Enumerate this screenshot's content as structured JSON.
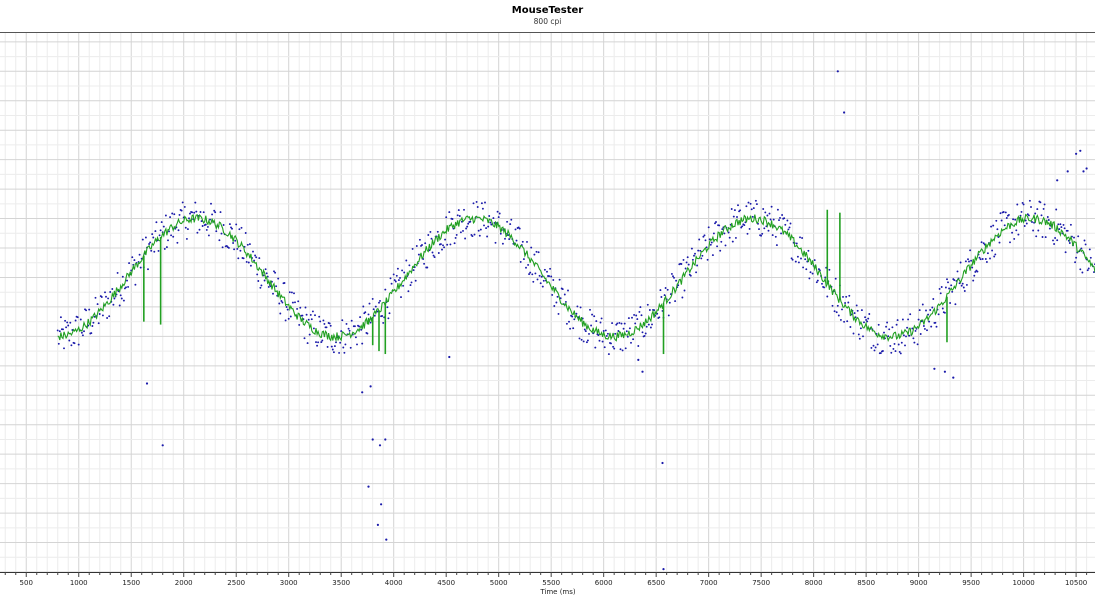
{
  "header": {
    "title": "MouseTester",
    "subtitle": "800 cpi"
  },
  "chart_data": {
    "type": "scatter",
    "title": "MouseTester",
    "subtitle": "800 cpi",
    "xlabel": "Time (ms)",
    "ylabel": "",
    "xlim": [
      250,
      10680
    ],
    "ylim": [
      -10,
      8.3
    ],
    "x_ticks": [
      500,
      1000,
      1500,
      2000,
      2500,
      3000,
      3500,
      4000,
      4500,
      5000,
      5500,
      6000,
      6500,
      7000,
      7500,
      8000,
      8500,
      9000,
      9500,
      10000,
      10500
    ],
    "grid": true,
    "legend": "none",
    "series": [
      {
        "role": "samples",
        "color": "#1a1aaa",
        "marker": "dot",
        "sine": {
          "x_start": 800,
          "x_end": 10700,
          "step": 10,
          "amplitude": 2.0,
          "period": 2650,
          "phase_x": 1460,
          "noise": 0.65
        },
        "outliers": [
          {
            "x": 1650,
            "y": -3.6
          },
          {
            "x": 1800,
            "y": -5.7
          },
          {
            "x": 3700,
            "y": -3.9
          },
          {
            "x": 3780,
            "y": -3.7
          },
          {
            "x": 3800,
            "y": -5.5
          },
          {
            "x": 3870,
            "y": -5.7
          },
          {
            "x": 3920,
            "y": -5.5
          },
          {
            "x": 3760,
            "y": -7.1
          },
          {
            "x": 3880,
            "y": -7.7
          },
          {
            "x": 3850,
            "y": -8.4
          },
          {
            "x": 3930,
            "y": -8.9
          },
          {
            "x": 4530,
            "y": -2.7
          },
          {
            "x": 6330,
            "y": -2.8
          },
          {
            "x": 6370,
            "y": -3.2
          },
          {
            "x": 6560,
            "y": -6.3
          },
          {
            "x": 6570,
            "y": -9.9
          },
          {
            "x": 8230,
            "y": 7.0
          },
          {
            "x": 8290,
            "y": 5.6
          },
          {
            "x": 9150,
            "y": -3.1
          },
          {
            "x": 9250,
            "y": -3.2
          },
          {
            "x": 9330,
            "y": -3.4
          },
          {
            "x": 10500,
            "y": 4.2
          },
          {
            "x": 10540,
            "y": 4.3
          },
          {
            "x": 10570,
            "y": 3.6
          },
          {
            "x": 10600,
            "y": 3.7
          },
          {
            "x": 10320,
            "y": 3.3
          },
          {
            "x": 10420,
            "y": 3.6
          }
        ]
      },
      {
        "role": "moving-average",
        "color": "#22a022",
        "marker": "line",
        "sine": {
          "x_start": 800,
          "x_end": 10700,
          "step": 10,
          "amplitude": 2.0,
          "period": 2650,
          "phase_x": 1460,
          "noise": 0.15
        },
        "spikes": [
          {
            "x": 1620,
            "y": -1.5
          },
          {
            "x": 1780,
            "y": -1.6
          },
          {
            "x": 3760,
            "y": -1.6
          },
          {
            "x": 3800,
            "y": -2.3
          },
          {
            "x": 3860,
            "y": -2.5
          },
          {
            "x": 3920,
            "y": -2.6
          },
          {
            "x": 6570,
            "y": -2.6
          },
          {
            "x": 8130,
            "y": 2.3
          },
          {
            "x": 8250,
            "y": 2.2
          },
          {
            "x": 9270,
            "y": -2.2
          }
        ]
      }
    ]
  }
}
